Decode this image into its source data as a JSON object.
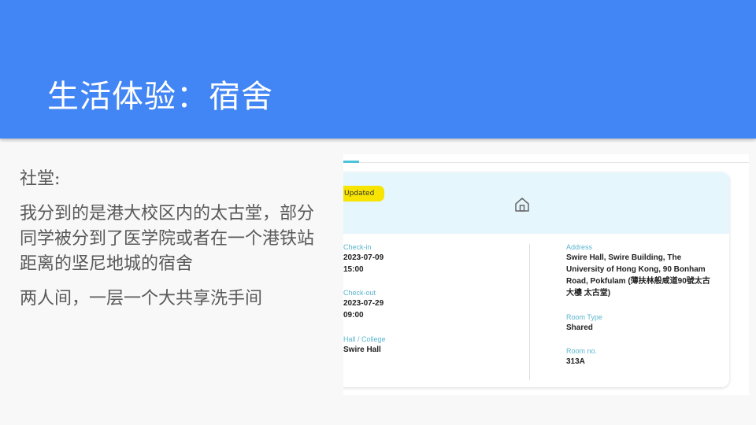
{
  "slide": {
    "title": "生活体验：宿舍",
    "paragraphs": [
      "社堂:",
      "我分到的是港大校区内的太古堂，部分同学被分到了医学院或者在一个港铁站距离的坚尼地城的宿舍",
      "两人间，一层一个大共享洗手间"
    ]
  },
  "booking": {
    "badge": "Updated",
    "icon": "home-icon",
    "checkin": {
      "label": "Check-in",
      "date": "2023-07-09",
      "time": "15:00"
    },
    "checkout": {
      "label": "Check-out",
      "date": "2023-07-29",
      "time": "09:00"
    },
    "hall": {
      "label": "Hall / College",
      "value": "Swire Hall"
    },
    "address": {
      "label": "Address",
      "value": "Swire Hall, Swire Building, The University of Hong Kong, 90 Bonham Road, Pokfulam (薄扶林般咸道90號太古大樓 太古堂)"
    },
    "room_type": {
      "label": "Room Type",
      "value": "Shared"
    },
    "room_no": {
      "label": "Room no.",
      "value": "313A"
    }
  },
  "colors": {
    "header": "#4285f4",
    "banner": "#e5f6fc",
    "badge": "#f7e400",
    "label": "#5cb6cf",
    "accent_tab": "#4dc3d9"
  }
}
